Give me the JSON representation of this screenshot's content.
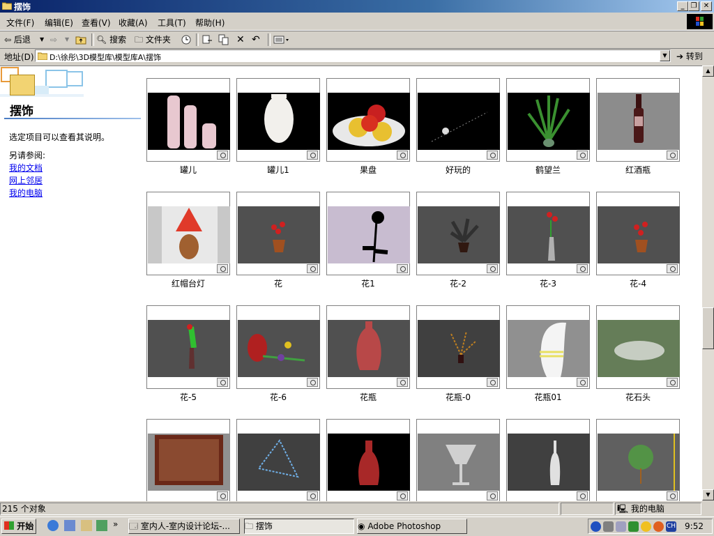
{
  "window": {
    "title": "摆饰"
  },
  "menu": [
    "文件(F)",
    "编辑(E)",
    "查看(V)",
    "收藏(A)",
    "工具(T)",
    "帮助(H)"
  ],
  "toolbar": {
    "back": "后退",
    "search": "搜索",
    "folders": "文件夹"
  },
  "address": {
    "label": "地址(D)",
    "path": "D:\\徐彤\\3D模型库\\模型库A\\摆饰",
    "go": "转到"
  },
  "leftpane": {
    "title": "摆饰",
    "hint": "选定项目可以查看其说明。",
    "see_also": "另请参阅:",
    "links": [
      "我的文档",
      "网上邻居",
      "我的电脑"
    ]
  },
  "items": [
    {
      "name": "罐儿"
    },
    {
      "name": "罐儿1"
    },
    {
      "name": "果盘"
    },
    {
      "name": "好玩的"
    },
    {
      "name": "鹤望兰"
    },
    {
      "name": "红酒瓶"
    },
    {
      "name": "红帽台灯"
    },
    {
      "name": "花"
    },
    {
      "name": "花1"
    },
    {
      "name": "花-2"
    },
    {
      "name": "花-3"
    },
    {
      "name": "花-4"
    },
    {
      "name": "花-5"
    },
    {
      "name": "花-6"
    },
    {
      "name": "花瓶"
    },
    {
      "name": "花瓶-0"
    },
    {
      "name": "花瓶01"
    },
    {
      "name": "花石头"
    },
    {
      "name": ""
    },
    {
      "name": ""
    },
    {
      "name": ""
    },
    {
      "name": ""
    },
    {
      "name": ""
    },
    {
      "name": ""
    }
  ],
  "status": {
    "count": "215 个对象",
    "location": "我的电脑"
  },
  "taskbar": {
    "start": "开始",
    "tasks": [
      "室内人-室内设计论坛-...",
      "摆饰",
      "Adobe Photoshop"
    ],
    "lang": "CH",
    "time": "9:52"
  }
}
